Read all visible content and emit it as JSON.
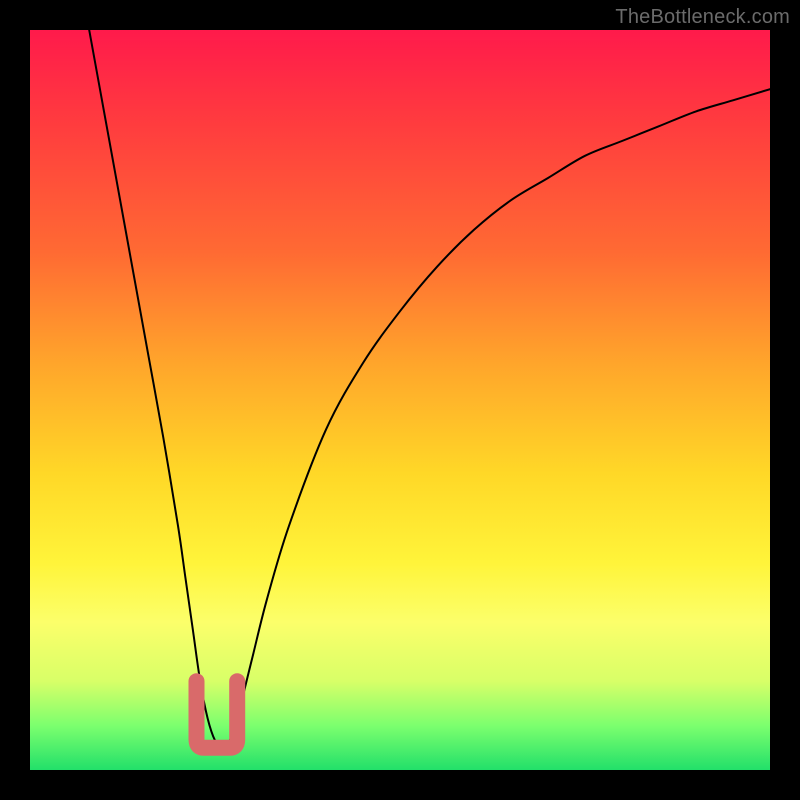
{
  "watermark": "TheBottleneck.com",
  "chart_data": {
    "type": "line",
    "title": "",
    "xlabel": "",
    "ylabel": "",
    "ylim": [
      0,
      100
    ],
    "xlim": [
      0,
      100
    ],
    "series": [
      {
        "name": "curve",
        "x": [
          8,
          10,
          12,
          14,
          16,
          18,
          20,
          21,
          22,
          23,
          24,
          25,
          26,
          27,
          28,
          30,
          32,
          35,
          40,
          45,
          50,
          55,
          60,
          65,
          70,
          75,
          80,
          85,
          90,
          95,
          100
        ],
        "values": [
          100,
          89,
          78,
          67,
          56,
          45,
          33,
          26,
          19,
          12,
          7,
          4,
          3,
          4,
          7,
          15,
          23,
          33,
          46,
          55,
          62,
          68,
          73,
          77,
          80,
          83,
          85,
          87,
          89,
          90.5,
          92
        ]
      }
    ],
    "marker": {
      "name": "bottleneck-marker",
      "shape": "U",
      "color": "#d96a6a",
      "x_range": [
        22.5,
        28
      ],
      "y_range": [
        3,
        12
      ]
    },
    "gradient_stops": [
      {
        "pos": 0,
        "color": "#ff1a4b"
      },
      {
        "pos": 12,
        "color": "#ff3a3f"
      },
      {
        "pos": 30,
        "color": "#ff6a33"
      },
      {
        "pos": 45,
        "color": "#ffa52b"
      },
      {
        "pos": 60,
        "color": "#ffd827"
      },
      {
        "pos": 72,
        "color": "#fff43a"
      },
      {
        "pos": 80,
        "color": "#fcff6a"
      },
      {
        "pos": 88,
        "color": "#d8ff68"
      },
      {
        "pos": 94,
        "color": "#7cff6e"
      },
      {
        "pos": 100,
        "color": "#22e06a"
      }
    ]
  }
}
